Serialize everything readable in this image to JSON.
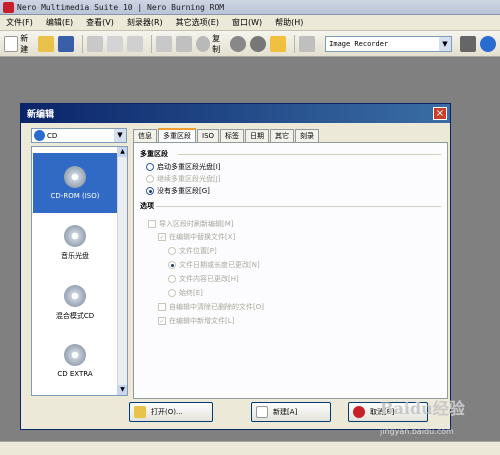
{
  "window": {
    "title": "Nero Multimedia Suite 10 | Nero Burning ROM"
  },
  "menubar": {
    "items": [
      "文件(F)",
      "编辑(E)",
      "查看(V)",
      "刻录器(R)",
      "其它选项(E)",
      "窗口(W)",
      "帮助(H)"
    ]
  },
  "toolbar": {
    "new_label": "新建",
    "copy_label": "复制",
    "recorder": "Image Recorder"
  },
  "dialog": {
    "title": "新编辑",
    "disc_type": "CD",
    "disc_items": [
      {
        "label": "CD-ROM (ISO)"
      },
      {
        "label": "音乐光盘"
      },
      {
        "label": "混合模式CD"
      },
      {
        "label": "CD EXTRA"
      }
    ],
    "tabs": [
      "信息",
      "多重区段",
      "ISO",
      "标签",
      "日期",
      "其它",
      "刻录"
    ],
    "active_tab": "多重区段",
    "multisession": {
      "header": "多重区段",
      "options": [
        "启动多重区段光盘[I]",
        "继续多重区段光盘[J]",
        "没有多重区段[G]"
      ]
    },
    "options_section": {
      "header": "选项",
      "items": [
        "导入区段时刷新编辑[M]",
        "在编辑中替换文件[X]",
        "文件位置[P]",
        "文件日期或长度已更改[N]",
        "文件内容已更改[H]",
        "始终[E]",
        "自编辑中清除已删除的文件[O]",
        "在编辑中新增文件[L]"
      ]
    },
    "buttons": {
      "open": "打开(O)...",
      "new": "新建[A]",
      "cancel": "取消[B]"
    }
  },
  "watermark": {
    "logo": "Baidu经验",
    "url": "jingyan.baidu.com"
  }
}
